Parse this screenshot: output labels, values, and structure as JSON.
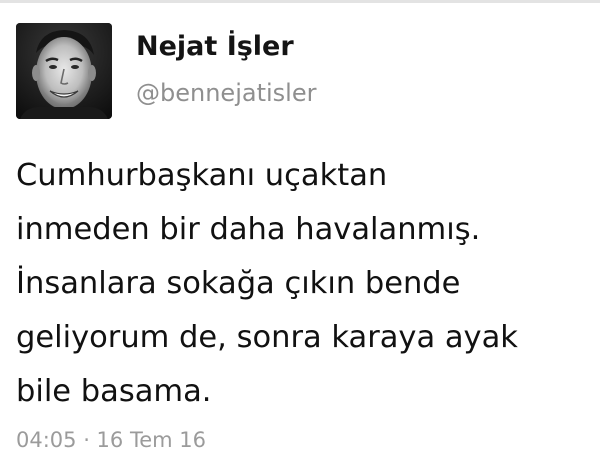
{
  "user": {
    "display_name": "Nejat İşler",
    "handle": "@bennejatisler"
  },
  "tweet": {
    "lines": [
      "Cumhurbaşkanı uçaktan",
      "inmeden bir daha havalanmış.",
      "İnsanlara sokağa çıkın bende",
      "geliyorum de, sonra karaya ayak",
      "bile basama."
    ],
    "timestamp": "04:05 · 16 Tem 16"
  },
  "colors": {
    "name_text": "#141414",
    "handle_text": "#8f8f8f",
    "tweet_text": "#111111",
    "timestamp_text": "#9b9b9b",
    "background": "#ffffff"
  }
}
